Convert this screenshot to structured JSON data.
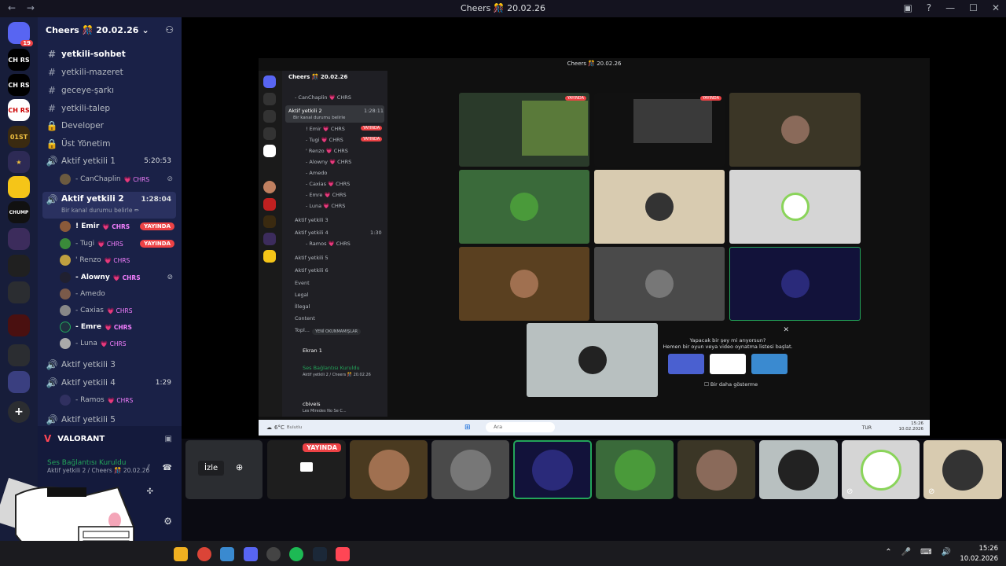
{
  "window": {
    "title": "Cheers 🎊 20.02.26",
    "back": "←",
    "forward": "→"
  },
  "servers": [
    {
      "label": "19",
      "kind": "badge"
    },
    {
      "label": "CH RS"
    },
    {
      "label": "CH RS"
    },
    {
      "label": "CH RS"
    },
    {
      "label": "01ST"
    },
    {
      "label": "★"
    },
    {
      "label": ""
    },
    {
      "label": "CHUMP"
    }
  ],
  "sidebar": {
    "server_name": "Cheers 🎊 20.02.26",
    "channels": [
      {
        "icon": "#",
        "label": "yetkili-sohbet",
        "bold": true
      },
      {
        "icon": "#",
        "label": "yetkili-mazeret"
      },
      {
        "icon": "#",
        "label": "geceye-şarkı"
      },
      {
        "icon": "#",
        "label": "yetkili-talep"
      },
      {
        "icon": "🔒",
        "label": "Developer"
      },
      {
        "icon": "🔒",
        "label": "Üst Yönetim"
      }
    ],
    "voice1": {
      "label": "Aktif yetkili 1",
      "time": "5:20:53"
    },
    "voice1_users": [
      {
        "name": "- CanChaplin",
        "tag": "💗 CHRS"
      }
    ],
    "voice2": {
      "label": "Aktif yetkili 2",
      "time": "1:28:04",
      "status": "Bir kanal durumu belirle ✏"
    },
    "voice2_users": [
      {
        "name": "! Emir",
        "tag": "💗 CHRS",
        "live": "YAYINDA"
      },
      {
        "name": "- Tugi",
        "tag": "💗 CHRS",
        "live": "YAYINDA"
      },
      {
        "name": "' Renzo",
        "tag": "💗 CHRS"
      },
      {
        "name": "- Alowny",
        "tag": "💗 CHRS"
      },
      {
        "name": "- Amedo",
        "tag": ""
      },
      {
        "name": "- Caxias",
        "tag": "💗 CHRS"
      },
      {
        "name": "- Emre",
        "tag": "💗 CHRS"
      },
      {
        "name": "- Luna",
        "tag": "💗 CHRS"
      }
    ],
    "voice3": {
      "label": "Aktif yetkili 3"
    },
    "voice4": {
      "label": "Aktif yetkili 4",
      "time": "1:29"
    },
    "voice4_users": [
      {
        "name": "- Ramos",
        "tag": "💗 CHRS"
      }
    ],
    "voice5": {
      "label": "Aktif yetkili 5"
    }
  },
  "voice_panel": {
    "game": "VALORANT",
    "connection": "Ses Bağlantısı Kuruldu",
    "sub": "Aktif yetkili 2 / Cheers 🎊 20.02.26"
  },
  "inner": {
    "title": "Cheers 🎊 20.02.26",
    "server": "Cheers 🎊 20.02.26",
    "channels": [
      {
        "label": "- CanChaplin 💗 CHRS"
      },
      {
        "label": "Aktif yetkili 2",
        "time": "1:28:11"
      },
      {
        "label": "Bir kanal durumu belirle"
      },
      {
        "label": "! Emir 💗 CHRS",
        "live": "YAYINDA"
      },
      {
        "label": "- Tugi 💗 CHRS",
        "live": "YAYINDA"
      },
      {
        "label": "' Renzo 💗 CHRS"
      },
      {
        "label": "- Alowny 💗 CHRS"
      },
      {
        "label": "- Amedo"
      },
      {
        "label": "- Caxias 💗 CHRS"
      },
      {
        "label": "- Emre 💗 CHRS"
      },
      {
        "label": "- Luna 💗 CHRS"
      },
      {
        "label": "Aktif yetkili 3"
      },
      {
        "label": "Aktif yetkili 4",
        "time": "1:30"
      },
      {
        "label": "- Ramos 💗 CHRS"
      },
      {
        "label": "Aktif yetkili 5"
      },
      {
        "label": "Aktif yetkili 6"
      },
      {
        "label": "Event"
      },
      {
        "label": "Legal"
      },
      {
        "label": "İllegal"
      },
      {
        "label": "Content"
      },
      {
        "label": "Topl..."
      }
    ],
    "unread": "YENİ OKUNMAMIŞLAR",
    "screen": "Ekran 1",
    "conn": "Ses Bağlantısı Kuruldu",
    "conn_sub": "Aktif yetkili 2 / Cheers 🎊 20.02.26",
    "user": "cbiveis",
    "user_sub": "Les Miredes No Se C..."
  },
  "popup": {
    "line1": "Yapacak bir şey mi arıyorsun?",
    "line2": "Hemen bir oyun veya video oynatma listesi başlat.",
    "checkbox": "Bir daha gösterme"
  },
  "inner_taskbar": {
    "weather": "6°C",
    "weather_sub": "Bulutlu",
    "search": "Ara",
    "lang": "TUR",
    "time": "15:26",
    "date": "10.02.2026"
  },
  "strip": {
    "watch": "İzle",
    "live": "YAYINDA"
  },
  "taskbar": {
    "time": "15:26",
    "date": "10.02.2026"
  }
}
